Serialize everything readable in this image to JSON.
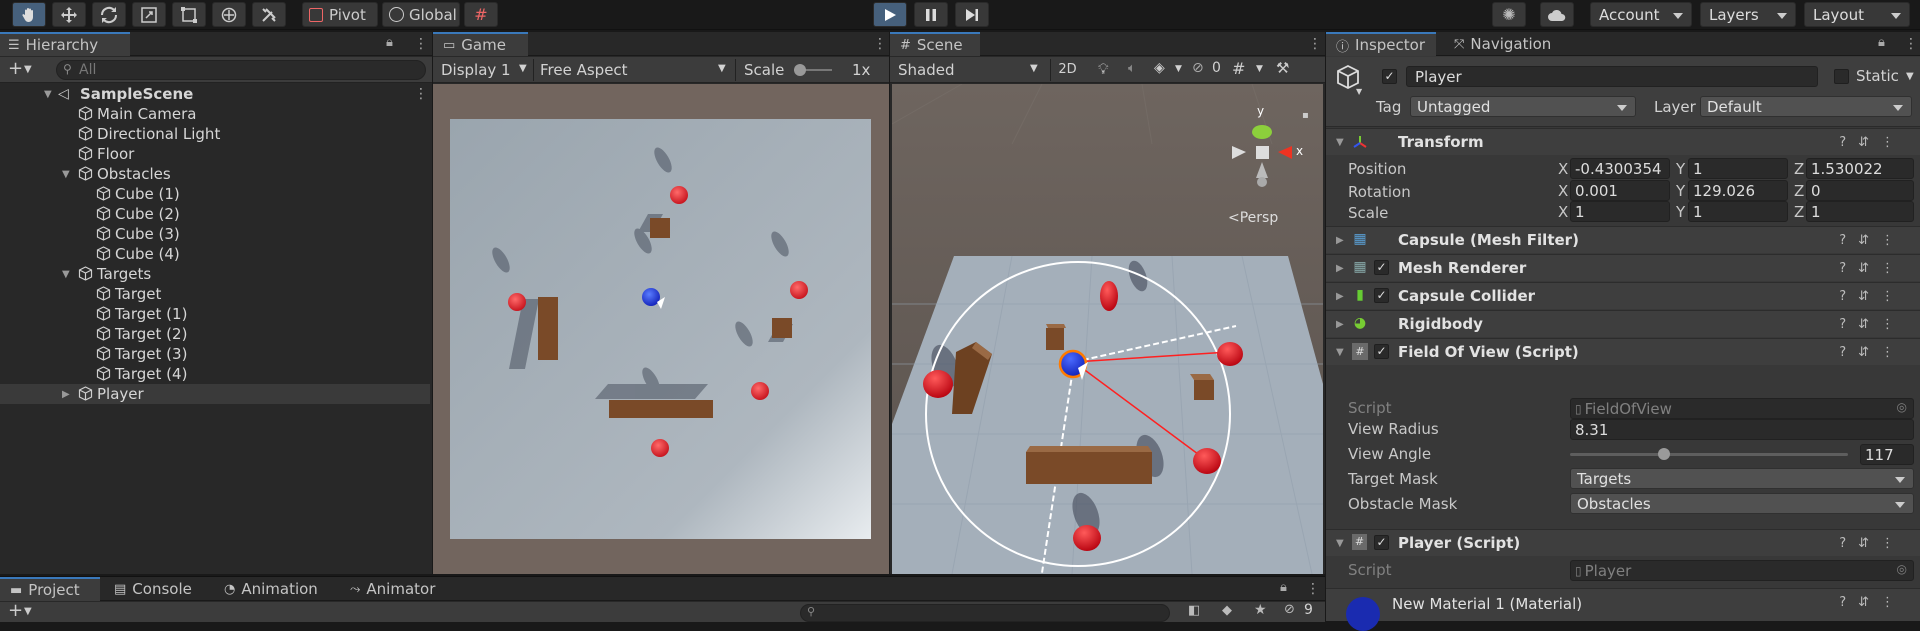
{
  "toolbar": {
    "pivot_label": "Pivot",
    "global_label": "Global",
    "account_label": "Account",
    "layers_label": "Layers",
    "layout_label": "Layout"
  },
  "hierarchy": {
    "tab_label": "Hierarchy",
    "search_placeholder": "All",
    "scene_name": "SampleScene",
    "items": [
      {
        "label": "Main Camera"
      },
      {
        "label": "Directional Light"
      },
      {
        "label": "Floor"
      },
      {
        "label": "Obstacles"
      },
      {
        "label": "Cube (1)"
      },
      {
        "label": "Cube (2)"
      },
      {
        "label": "Cube (3)"
      },
      {
        "label": "Cube (4)"
      },
      {
        "label": "Targets"
      },
      {
        "label": "Target"
      },
      {
        "label": "Target (1)"
      },
      {
        "label": "Target (2)"
      },
      {
        "label": "Target (3)"
      },
      {
        "label": "Target (4)"
      },
      {
        "label": "Player"
      }
    ]
  },
  "game": {
    "tab_label": "Game",
    "display_label": "Display 1",
    "aspect_label": "Free Aspect",
    "scale_label": "Scale",
    "scale_value": "1x"
  },
  "scene": {
    "tab_label": "Scene",
    "shading_label": "Shaded",
    "mode_2d_label": "2D",
    "hidden_count": "0",
    "persp_label": "Persp",
    "axis_y": "y",
    "axis_x": "x"
  },
  "inspector": {
    "tab_label": "Inspector",
    "nav_tab_label": "Navigation",
    "object_name": "Player",
    "static_label": "Static",
    "tag_label": "Tag",
    "tag_value": "Untagged",
    "layer_label": "Layer",
    "layer_value": "Default",
    "transform": {
      "title": "Transform",
      "position_label": "Position",
      "rotation_label": "Rotation",
      "scale_label": "Scale",
      "x": "X",
      "y": "Y",
      "z": "Z",
      "position": [
        "-0.4300354",
        "1",
        "1.530022"
      ],
      "rotation": [
        "0.001",
        "129.026",
        "0"
      ],
      "scale": [
        "1",
        "1",
        "1"
      ]
    },
    "components": {
      "mesh_filter": "Capsule (Mesh Filter)",
      "mesh_renderer": "Mesh Renderer",
      "capsule_collider": "Capsule Collider",
      "rigidbody": "Rigidbody",
      "fov": "Field Of View (Script)",
      "player_script": "Player (Script)",
      "material": "New Material 1 (Material)"
    },
    "fov": {
      "script_label": "Script",
      "script_value": "FieldOfView",
      "radius_label": "View Radius",
      "radius_value": "8.31",
      "angle_label": "View Angle",
      "angle_value": "117",
      "target_mask_label": "Target Mask",
      "target_mask_value": "Targets",
      "obstacle_mask_label": "Obstacle Mask",
      "obstacle_mask_value": "Obstacles"
    },
    "player": {
      "script_label": "Script",
      "script_value": "Player"
    }
  },
  "bottom": {
    "tabs": [
      "Project",
      "Console",
      "Animation",
      "Animator"
    ],
    "hidden_count": "9"
  }
}
